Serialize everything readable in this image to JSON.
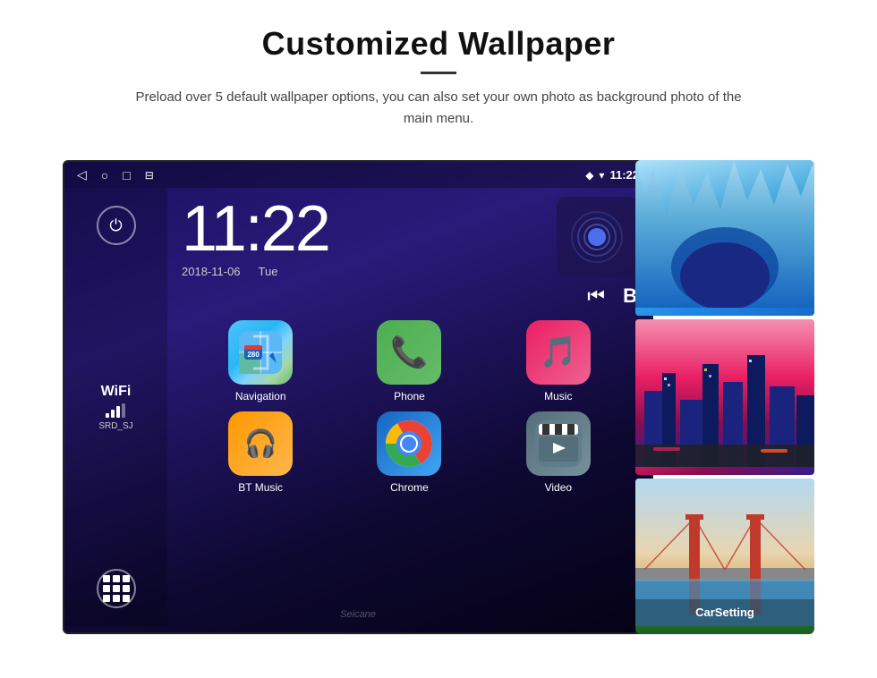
{
  "header": {
    "title": "Customized Wallpaper",
    "subtitle": "Preload over 5 default wallpaper options, you can also set your own photo as background photo of the main menu."
  },
  "status_bar": {
    "time": "11:22",
    "location_icon": "📍",
    "wifi_icon": "▾"
  },
  "clock": {
    "time": "11:22",
    "date": "2018-11-06",
    "day": "Tue"
  },
  "wifi": {
    "label": "WiFi",
    "ssid": "SRD_SJ"
  },
  "apps": [
    {
      "name": "Navigation",
      "icon_type": "navigation"
    },
    {
      "name": "Phone",
      "icon_type": "phone"
    },
    {
      "name": "Music",
      "icon_type": "music"
    },
    {
      "name": "BT Music",
      "icon_type": "btmusic"
    },
    {
      "name": "Chrome",
      "icon_type": "chrome"
    },
    {
      "name": "Video",
      "icon_type": "video"
    }
  ],
  "wallpaper_thumbnails": [
    {
      "name": "ice-cave",
      "label": "Ice Cave"
    },
    {
      "name": "city-night",
      "label": "City"
    },
    {
      "name": "bridge",
      "label": "Bridge"
    }
  ],
  "watermark": "Seicane",
  "sidebar": {
    "car_setting": "CarSetting"
  }
}
